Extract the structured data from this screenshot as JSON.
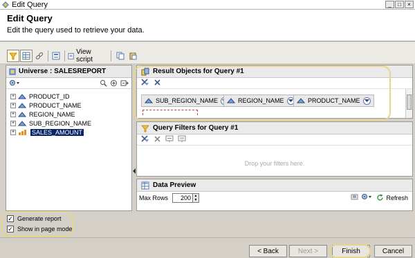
{
  "window": {
    "title": "Edit Query"
  },
  "header": {
    "title": "Edit Query",
    "description": "Edit the query used to retrieve your data."
  },
  "toolbar": {
    "view_script_label": "View script"
  },
  "universe": {
    "title": "Universe : SALESREPORT",
    "items": [
      {
        "label": "PRODUCT_ID",
        "type": "dimension",
        "selected": false
      },
      {
        "label": "PRODUCT_NAME",
        "type": "dimension",
        "selected": false
      },
      {
        "label": "REGION_NAME",
        "type": "dimension",
        "selected": false
      },
      {
        "label": "SUB_REGION_NAME",
        "type": "dimension",
        "selected": false
      },
      {
        "label": "SALES_AMOUNT",
        "type": "measure",
        "selected": true
      }
    ]
  },
  "result_objects": {
    "title": "Result Objects for Query #1",
    "objects": [
      "SUB_REGION_NAME",
      "REGION_NAME",
      "PRODUCT_NAME"
    ]
  },
  "query_filters": {
    "title": "Query Filters for Query #1",
    "placeholder": "Drop your filters here."
  },
  "data_preview": {
    "title": "Data Preview",
    "max_rows_label": "Max Rows",
    "max_rows_value": "200",
    "refresh_label": "Refresh"
  },
  "options": [
    {
      "label": "Generate report",
      "checked": true
    },
    {
      "label": "Show in page mode",
      "checked": true
    }
  ],
  "footer": {
    "back_label": "< Back",
    "next_label": "Next >",
    "finish_label": "Finish",
    "cancel_label": "Cancel"
  },
  "colors": {
    "highlight": "#e8d48a",
    "selection": "#0a246a"
  }
}
